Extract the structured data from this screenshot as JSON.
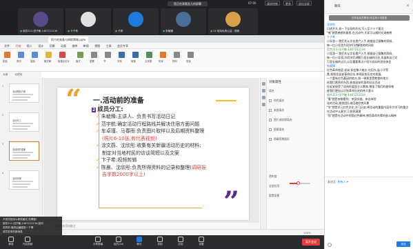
{
  "meeting": {
    "title": "您正在观看女儿的屏幕",
    "time": "07:00",
    "top_buttons": [
      "请求控制",
      "更多",
      "退出全屏"
    ],
    "participants": [
      {
        "name": "软件211-田子敏-1467211134",
        "avatar_color": "#5a4a8a"
      },
      {
        "name": "卡子希",
        "avatar_color": "#e0e0e0"
      },
      {
        "name": "子希",
        "avatar_color": "#1e7be0"
      },
      {
        "name": "朱毓臻",
        "avatar_color": "#4a6e9a"
      },
      {
        "name": "24 哈哈玩具公益 - 视频",
        "avatar_color": "#d8a14a"
      }
    ],
    "toolbar": [
      {
        "label": "静音"
      },
      {
        "label": "开启视频"
      },
      {
        "label": "共享屏幕"
      },
      {
        "label": "成员(26)"
      },
      {
        "label": "聊天",
        "active": true
      },
      {
        "label": "录制"
      },
      {
        "label": "应用"
      },
      {
        "label": "设置"
      }
    ],
    "end_label": "离开会议"
  },
  "wps": {
    "doc_tab": "同方的准备与捐助策略.pptx",
    "menus": [
      "文件",
      "开始",
      "插入",
      "设计",
      "切换",
      "动画",
      "放映",
      "审阅",
      "视图",
      "工具",
      "会员专享"
    ],
    "active_menu": "开始",
    "ribbon": [
      "粘贴",
      "剪切",
      "复制",
      "格式刷",
      "新建幻灯片",
      "版式",
      "重置",
      "节",
      "字体",
      "段落",
      "文本框",
      "形状",
      "排列",
      "查找"
    ],
    "subtabs": [
      "大纲",
      "幻灯片"
    ],
    "thumbs": [
      {
        "num": "1",
        "title": "活动策划方案"
      },
      {
        "num": "2",
        "title": "活动分工"
      },
      {
        "num": "3",
        "title": "活动前的准备"
      },
      {
        "num": "4",
        "title": "活动流程"
      }
    ],
    "props": {
      "title": "对象属性",
      "labels": [
        "填充",
        "纯色填充",
        "渐变填充",
        "图片或纹理填充",
        "图案填充",
        "隐藏背景图形",
        "透明度",
        "全部应用",
        "重置背景"
      ]
    },
    "notes_placeholder": "单击此处添加备注",
    "status_left": "幻灯片 3 / 5",
    "status_right": "100%"
  },
  "slide": {
    "title": "一.活动前的准备",
    "section_num": "2",
    "section_title": "成员分工:",
    "bullets": [
      {
        "text": "朱毓臻:主讲人、负责书写活动日记"
      },
      {
        "text": "范宇航:确定活动行程路线并解决住宿方面问题"
      },
      {
        "text": "车卓瑾、马春雨:负责图片取样以及后期资料整理"
      },
      {
        "text": "(照片6-10张,有代表视频)",
        "cont": true,
        "hl": true
      },
      {
        "text": "涂文蔚、沈欣彤:收集有关新疆活动历史的材料;"
      },
      {
        "text": "制定对当地村民的访谈简短以及文案",
        "cont": true
      },
      {
        "text": "卞子希:视频剪辑"
      },
      {
        "text": "陈晨、沈欣彤:负责所得资料的记录和整理(调研报",
        "hl_tail": "调研报"
      },
      {
        "text": "告字数2000字以上)",
        "cont": true,
        "hl": true
      }
    ]
  },
  "overlay": {
    "lines": [
      "不然文档怎么修改格式,在哪做?",
      "软件211-田子敏-1467211134:如何",
      "范同学:做完后截图发一下啊",
      "成员发来的新消息"
    ]
  },
  "chat": {
    "title": "聊天",
    "notice": "已开启全员禁言,仅主持人可发言",
    "messages": [
      {
        "name": "沈欣彤",
        "text": "口述开头,说一下全局的形式,写入至少十个要点"
      },
      {
        "name": "",
        "text": "\"感\"就是感想的意思,在活动中,大家可以随时交流感想"
      },
      {
        "name": "卞子希",
        "text": "小导游一:我们先从文化遗产入手,根据自己搜集的资料,"
      },
      {
        "name": "",
        "text": "每一位小导游为同学们讲解各地的风俗"
      },
      {
        "name": "范宇211-田子敏-1467211134",
        "green": true,
        "text": "小导游一:我们先从文化遗产入手,根据自己搜集的资料,"
      },
      {
        "name": "",
        "text": "每一位小导游,为同学们讲解万里长城的历史,发展和自己对"
      },
      {
        "name": "",
        "text": "万里长城的认识,以及重要景点介绍与实际的游览体会"
      },
      {
        "name": "朱毓臻",
        "text": "红色革命摇篮·延安,如会聚人难忘,屯田东,延小平等"
      },
      {
        "name": "",
        "text": "桑,如前往延安革命旧址,参观延安历史的发展,"
      },
      {
        "name": "",
        "text": "一个富有红色基因的地方,到一律那里受教育的地方"
      },
      {
        "name": "",
        "text": "给我们营养的东西,参加延安的革命纪念活动"
      },
      {
        "name": "",
        "text": "在延安接受了深刻的爱国主义教育,增强了我们的使命感"
      },
      {
        "name": "",
        "text": "使我们更加认识到革命历史的伟大意义"
      },
      {
        "name": "软件211-田子敏-1467211134",
        "green": true,
        "text": "\"看\"就是亲眼看到、亲身实践、亲自体验"
      },
      {
        "name": "",
        "text": "化的活动,旅游团队来回地欣赏风景"
      },
      {
        "name": "",
        "text": "\"学\"就是学习红色文化,学习历史,将活动的重要内容作为学习的重点"
      },
      {
        "name": "",
        "text": "在活动中认真学习,收获满满"
      },
      {
        "name": "",
        "text": "\"悟\"就是在活动中领悟红色精神,感悟革命先辈的奋斗精神"
      }
    ],
    "send_to_label": "发送至:",
    "send_to_value": "所有人",
    "send_label": "发送"
  }
}
